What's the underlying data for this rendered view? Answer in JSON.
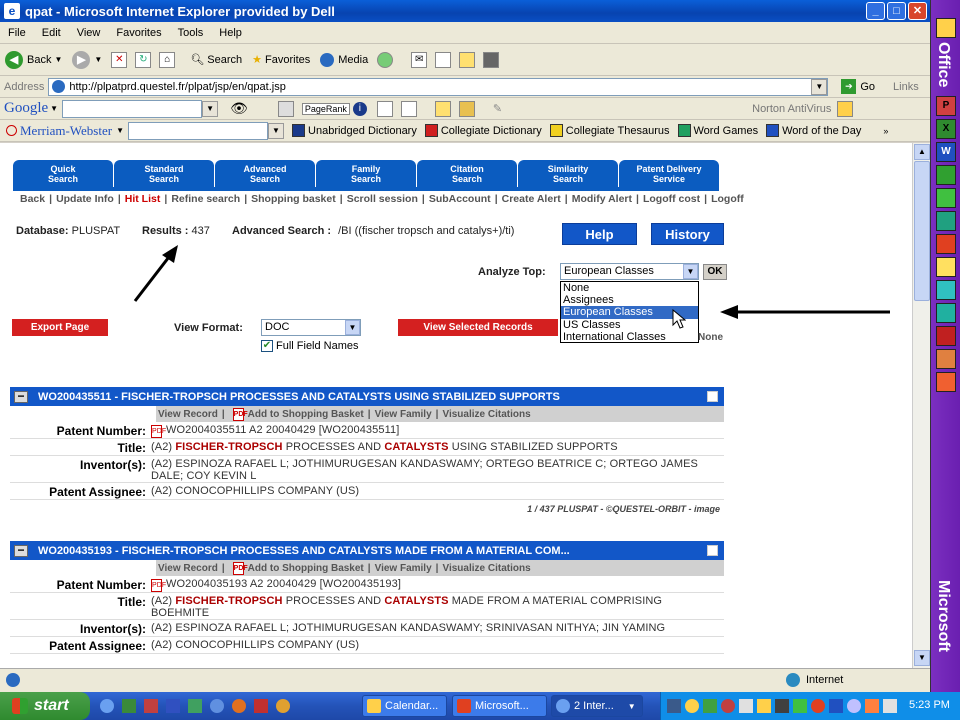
{
  "window": {
    "title": "qpat - Microsoft Internet Explorer provided by Dell",
    "buttons": {
      "minimize": "_",
      "maximize": "□",
      "close": "✕"
    }
  },
  "menu": [
    "File",
    "Edit",
    "View",
    "Favorites",
    "Tools",
    "Help"
  ],
  "toolbar": {
    "back": "Back",
    "search": "Search",
    "favorites": "Favorites",
    "media": "Media"
  },
  "address": {
    "label": "Address",
    "url": "http://plpatprd.questel.fr/plpat/jsp/en/qpat.jsp",
    "go": "Go",
    "links": "Links"
  },
  "googlebar": {
    "brand": "Google",
    "pagerank": "PageRank",
    "antivirus": "Norton AntiVirus"
  },
  "mwbar": {
    "brand": "Merriam-Webster",
    "items": [
      "Unabridged Dictionary",
      "Collegiate Dictionary",
      "Collegiate Thesaurus",
      "Word Games",
      "Word of the Day"
    ]
  },
  "officebar": {
    "office": "Office",
    "microsoft": "Microsoft"
  },
  "tabs": [
    {
      "line1": "Quick",
      "line2": "Search"
    },
    {
      "line1": "Standard",
      "line2": "Search"
    },
    {
      "line1": "Advanced",
      "line2": "Search"
    },
    {
      "line1": "Family",
      "line2": "Search"
    },
    {
      "line1": "Citation",
      "line2": "Search"
    },
    {
      "line1": "Similarity",
      "line2": "Search"
    },
    {
      "line1": "Patent Delivery",
      "line2": "Service"
    }
  ],
  "subnav": [
    "Back",
    "Update Info",
    "Hit List",
    "Refine search",
    "Shopping basket",
    "Scroll session",
    "SubAccount",
    "Create Alert",
    "Modify Alert",
    "Logoff cost",
    "Logoff"
  ],
  "info": {
    "database_label": "Database:",
    "database": "PLUSPAT",
    "results_label": "Results :",
    "results": "437",
    "advanced_label": "Advanced Search :",
    "query": "/BI ((fischer tropsch and catalys+)/ti)"
  },
  "buttons": {
    "help": "Help",
    "history": "History",
    "export": "Export Page",
    "view_selected": "View Selected Records",
    "ok": "OK"
  },
  "analyze": {
    "label": "Analyze Top:",
    "selected": "European Classes",
    "options": [
      "None",
      "Assignees",
      "European Classes",
      "US Classes",
      "International Classes"
    ],
    "trailing": "None"
  },
  "view_format": {
    "label": "View Format:",
    "value": "DOC",
    "full_field_names": "Full Field Names"
  },
  "record_actions": {
    "view_record": "View Record",
    "add_basket": "Add to Shopping Basket",
    "view_family": "View Family",
    "visualize": "Visualize Citations"
  },
  "field_labels": {
    "number": "Patent Number:",
    "title": "Title:",
    "inventors": "Inventor(s):",
    "assignee": "Patent Assignee:"
  },
  "records": [
    {
      "header": "WO200435511 - FISCHER-TROPSCH PROCESSES AND CATALYSTS USING STABILIZED SUPPORTS",
      "number": "WO2004035511 A2 20040429 [WO200435511]",
      "title_pre": "(A2)",
      "kw1": "FISCHER-TROPSCH",
      "title_mid": "PROCESSES AND",
      "kw2": "CATALYSTS",
      "title_post": "USING STABILIZED SUPPORTS",
      "inventors": "(A2) ESPINOZA RAFAEL L; JOTHIMURUGESAN KANDASWAMY; ORTEGO BEATRICE C; ORTEGO JAMES DALE; COY KEVIN L",
      "assignee": "(A2) CONOCOPHILLIPS COMPANY (US)",
      "footer": "1 / 437 PLUSPAT - ©QUESTEL-ORBIT - image"
    },
    {
      "header": "WO200435193 - FISCHER-TROPSCH PROCESSES AND CATALYSTS MADE FROM A MATERIAL COM...",
      "number": "WO2004035193 A2 20040429 [WO200435193]",
      "title_pre": "(A2)",
      "kw1": "FISCHER-TROPSCH",
      "title_mid": "PROCESSES AND",
      "kw2": "CATALYSTS",
      "title_post": "MADE FROM A MATERIAL COMPRISING BOEHMITE",
      "inventors": "(A2) ESPINOZA RAFAEL L; JOTHIMURUGESAN KANDASWAMY; SRINIVASAN NITHYA; JIN YAMING",
      "assignee": "(A2) CONOCOPHILLIPS COMPANY (US)"
    }
  ],
  "status": {
    "zone": "Internet"
  },
  "taskbar": {
    "start": "start",
    "tasks": [
      "Calendar...",
      "Microsoft...",
      "2 Inter..."
    ],
    "clock": "5:23 PM"
  },
  "colors": {
    "tab_blue": "#0b5cc0",
    "keyword": "#aa0000",
    "red_button": "#d42020"
  }
}
